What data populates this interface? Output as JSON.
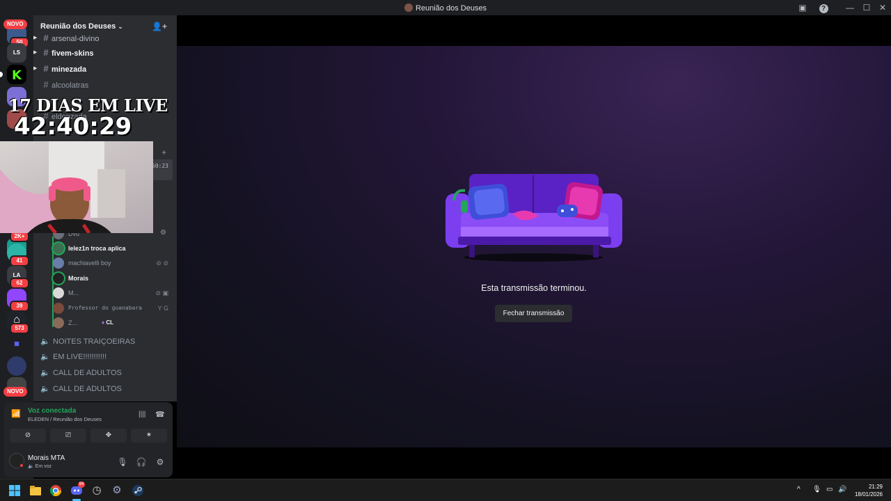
{
  "window": {
    "title": "Reunião dos Deuses"
  },
  "rail": {
    "novo_top": "NOVO",
    "novo_bottom": "NOVO",
    "badges": [
      "50",
      "2K+",
      "41",
      "62",
      "39",
      "573"
    ]
  },
  "server": {
    "name": "Reunião dos Deuses"
  },
  "channels": [
    {
      "name": "arsenal-divino",
      "unread": true
    },
    {
      "name": "fivem-skins",
      "unread": true
    },
    {
      "name": "minezada",
      "unread": true
    },
    {
      "name": "alcoolatras",
      "unread": false
    },
    {
      "name": "eldenzada",
      "unread": false
    }
  ],
  "overlay": {
    "days_text": "17 DIAS EM LIVE",
    "timer": "42:40:29",
    "side_timer": "50:23"
  },
  "voice_users": [
    {
      "name": "Dvd"
    },
    {
      "name": "lelez1n troca aplica"
    },
    {
      "name": "machiavelli boy"
    },
    {
      "name": "Morais"
    },
    {
      "name": "M..."
    },
    {
      "name": "Professor do guanabara"
    },
    {
      "name": "Z..."
    }
  ],
  "voice_user_tag": "CL",
  "voice_channels": [
    {
      "name": "NOITES TRAIÇOEIRAS"
    },
    {
      "name": "EM LIVE!!!!!!!!!!!"
    },
    {
      "name": "CALL DE ADULTOS"
    },
    {
      "name": "CALL DE ADULTOS"
    }
  ],
  "voice_panel": {
    "status": "Voz conectada",
    "location": "ELEDEN / Reunião dos Deuses"
  },
  "user_panel": {
    "name": "Morais MTA",
    "status": "Em voz"
  },
  "stage": {
    "message": "Esta transmissão terminou.",
    "close_button": "Fechar transmissão"
  },
  "taskbar": {
    "time": "21:29",
    "date": "18/01/2026",
    "discord_badge": "94"
  },
  "colors": {
    "accent_green": "#23a55a",
    "badge_red": "#f23f43",
    "blurple": "#5865f2",
    "couch_purple": "#6d2fe0"
  }
}
